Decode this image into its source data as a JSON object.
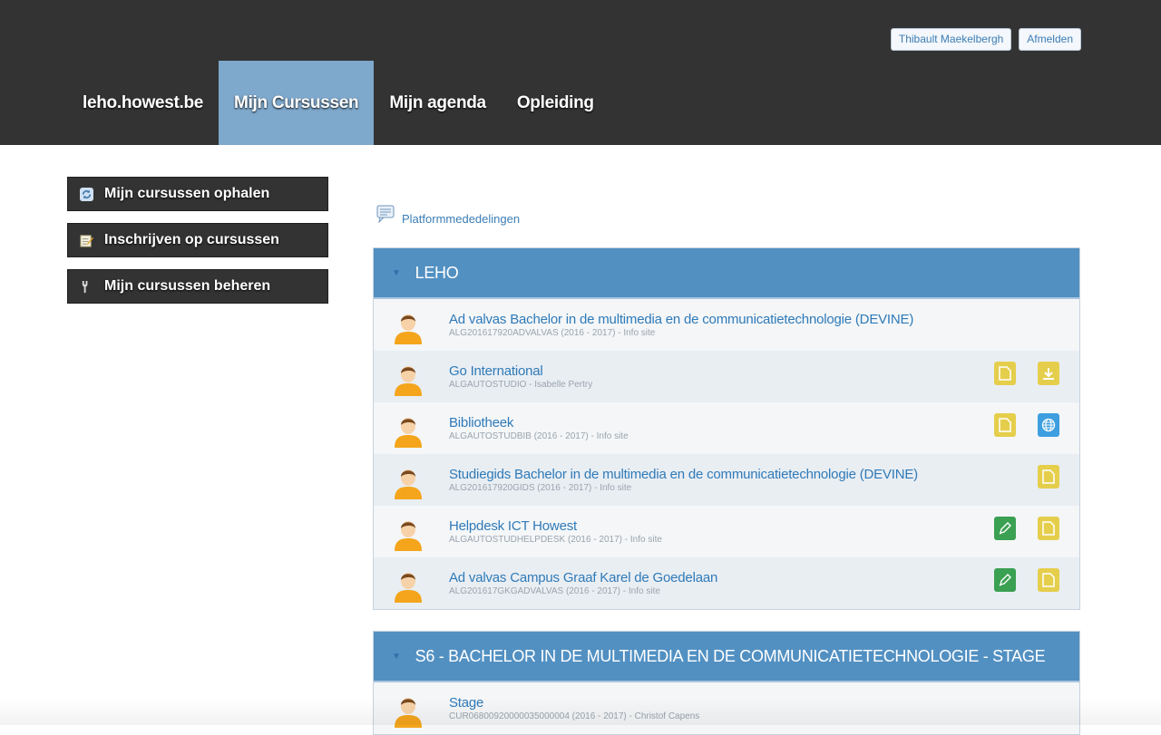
{
  "header": {
    "user_name": "Thibault Maekelbergh",
    "logout_label": "Afmelden",
    "nav": [
      {
        "label": "leho.howest.be"
      },
      {
        "label": "Mijn Cursussen"
      },
      {
        "label": "Mijn agenda"
      },
      {
        "label": "Opleiding"
      }
    ]
  },
  "sidebar": {
    "items": [
      {
        "label": "Mijn cursussen ophalen",
        "icon": "refresh-icon"
      },
      {
        "label": "Inschrijven op cursussen",
        "icon": "notepad-pencil-icon"
      },
      {
        "label": "Mijn cursussen beheren",
        "icon": "wrench-icon"
      }
    ]
  },
  "announcements": {
    "label": "Platformmededelingen",
    "icon": "speech-bubble-icon"
  },
  "groups": [
    {
      "title": "LEHO",
      "courses": [
        {
          "title": "Ad valvas Bachelor in de multimedia en de communicatietechnologie (DEVINE)",
          "subtitle": "ALG201617920ADVALVAS (2016 - 2017) - Info site",
          "actions": []
        },
        {
          "title": "Go International",
          "subtitle": "ALGAUTOSTUDIO - Isabelle Pertry",
          "actions": [
            "document-icon",
            "download-icon"
          ]
        },
        {
          "title": "Bibliotheek",
          "subtitle": "ALGAUTOSTUDBIB (2016 - 2017) - Info site",
          "actions": [
            "document-icon",
            "globe-icon"
          ]
        },
        {
          "title": "Studiegids Bachelor in de multimedia en de communicatietechnologie (DEVINE)",
          "subtitle": "ALG201617920GIDS (2016 - 2017) - Info site",
          "actions": [
            "document-icon"
          ]
        },
        {
          "title": "Helpdesk ICT Howest",
          "subtitle": "ALGAUTOSTUDHELPDESK (2016 - 2017) - Info site",
          "actions": [
            "edit-pen-icon",
            "document-icon"
          ]
        },
        {
          "title": "Ad valvas Campus Graaf Karel de Goedelaan",
          "subtitle": "ALG201617GKGADVALVAS (2016 - 2017) - Info site",
          "actions": [
            "edit-pen-icon",
            "document-icon"
          ]
        }
      ]
    },
    {
      "title": "S6 - BACHELOR IN DE MULTIMEDIA EN DE COMMUNICATIETECHNOLOGIE - STAGE",
      "courses": [
        {
          "title": "Stage",
          "subtitle": "CUR0680092000003500000​4 (2016 - 2017) - Christof Capens",
          "actions": []
        }
      ]
    }
  ],
  "colors": {
    "topbar": "#333333",
    "nav_active": "#7ea8cc",
    "group_header": "#5290c2",
    "link": "#2f7ab8"
  }
}
